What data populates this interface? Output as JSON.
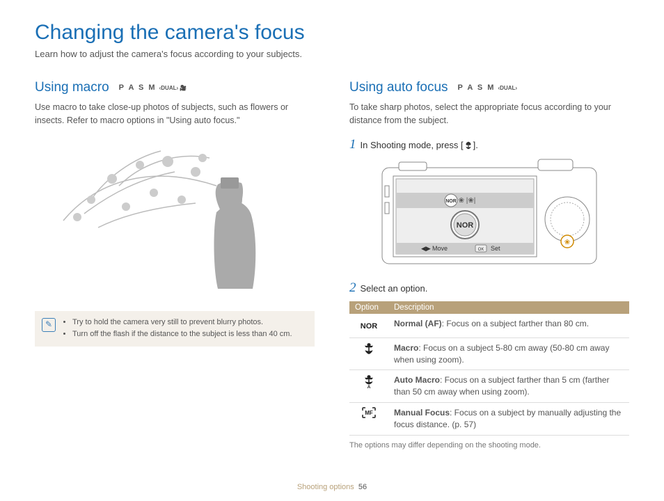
{
  "title": "Changing the camera's focus",
  "subtitle": "Learn how to adjust the camera's focus according to your subjects.",
  "left": {
    "heading": "Using macro",
    "modes": "P A S M",
    "modes_extra": "DUAL",
    "body": "Use macro to take close-up photos of subjects, such as flowers or insects. Refer to macro options in \"Using auto focus.\"",
    "tips": [
      "Try to hold the camera very still to prevent blurry photos.",
      "Turn off the flash if the distance to the subject is less than 40 cm."
    ]
  },
  "right": {
    "heading": "Using auto focus",
    "modes": "P A S M",
    "modes_extra": "DUAL",
    "body": "To take sharp photos, select the appropriate focus according to your distance from the subject.",
    "step1_prefix": "In Shooting mode, press [",
    "step1_suffix": "].",
    "camera_hint_move": "Move",
    "camera_hint_set": "Set",
    "camera_badge": "NOR",
    "step2": "Select an option.",
    "table": {
      "h1": "Option",
      "h2": "Description",
      "rows": [
        {
          "icon": "NOR",
          "title": "Normal (AF)",
          "desc": ": Focus on a subject farther than 80 cm."
        },
        {
          "icon": "macro",
          "title": "Macro",
          "desc": ": Focus on a subject 5-80 cm away (50-80 cm away when using zoom)."
        },
        {
          "icon": "automacro",
          "title": "Auto Macro",
          "desc": ": Focus on a subject farther than 5 cm (farther than 50 cm away when using zoom)."
        },
        {
          "icon": "MF",
          "title": "Manual Focus",
          "desc": ": Focus on a subject by manually adjusting the focus distance. (p. 57)"
        }
      ]
    },
    "note": "The options may differ depending on the shooting mode."
  },
  "footer": {
    "section": "Shooting options",
    "page": "56"
  }
}
